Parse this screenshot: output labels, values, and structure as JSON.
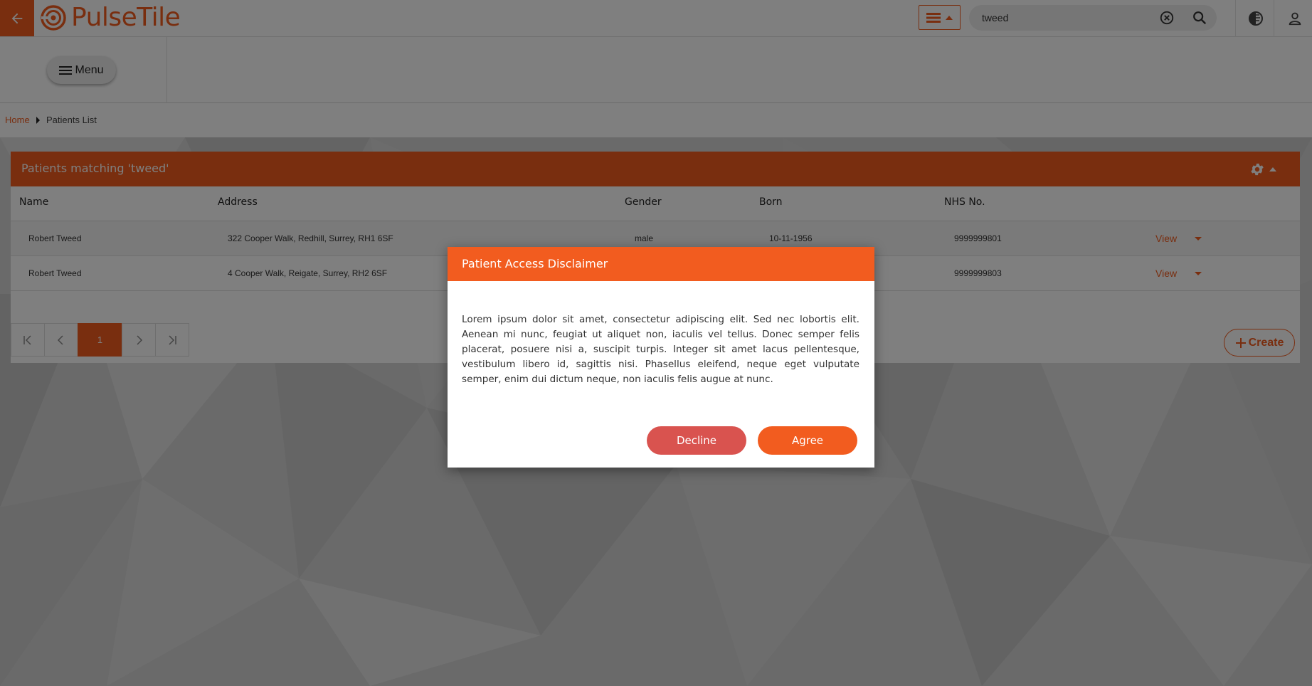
{
  "colors": {
    "accent": "#f25c1f",
    "decline": "#d9534f",
    "header_bg": "#ffffff"
  },
  "header": {
    "logo_text": "PulseTile",
    "search": {
      "value": "tweed"
    },
    "icons": [
      "back-arrow-icon",
      "list-icon",
      "clear-icon",
      "search-icon",
      "contrast-icon",
      "user-icon"
    ]
  },
  "menu": {
    "label": "Menu"
  },
  "breadcrumb": {
    "home": "Home",
    "current": "Patients List"
  },
  "panel": {
    "title": "Patients matching 'tweed'",
    "columns": [
      "Name",
      "Address",
      "Gender",
      "Born",
      "NHS No."
    ],
    "rows": [
      {
        "name": "Robert Tweed",
        "address": "322 Cooper Walk, Redhill, Surrey, RH1 6SF",
        "gender": "male",
        "born": "10-11-1956",
        "nhs": "9999999801",
        "action": "View"
      },
      {
        "name": "Robert Tweed",
        "address": "4 Cooper Walk, Reigate, Surrey, RH2 6SF",
        "gender": "",
        "born": "",
        "nhs": "9999999803",
        "action": "View"
      }
    ],
    "pagination": {
      "current_page": "1"
    },
    "create_label": "Create"
  },
  "modal": {
    "title": "Patient Access Disclaimer",
    "body": "Lorem ipsum dolor sit amet, consectetur adipiscing elit. Sed nec lobortis elit. Aenean mi nunc, feugiat ut aliquet non, iaculis vel tellus. Donec semper felis placerat, posuere nisi a, suscipit turpis. Integer sit amet lacus pellentesque, vestibulum libero id, sagittis nisi. Phasellus eleifend, neque eget vulputate semper, enim dui dictum neque, non iaculis felis augue at nunc.",
    "decline_label": "Decline",
    "agree_label": "Agree"
  }
}
